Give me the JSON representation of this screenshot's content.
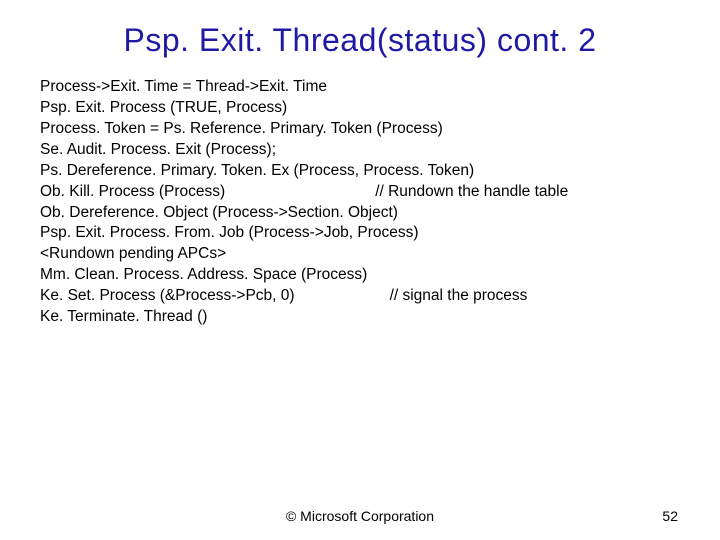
{
  "title": "Psp. Exit. Thread(status) cont. 2",
  "lines": {
    "l0": "Process->Exit. Time = Thread->Exit. Time",
    "l1": "Psp. Exit. Process (TRUE, Process)",
    "l2": "Process. Token = Ps. Reference. Primary. Token (Process)",
    "l3": "Se. Audit. Process. Exit (Process);",
    "l4": "Ps. Dereference. Primary. Token. Ex (Process, Process. Token)",
    "l5_left": "Ob. Kill. Process (Process)",
    "l5_right": "// Rundown the handle table",
    "l6": "Ob. Dereference. Object (Process->Section. Object)",
    "l7": "Psp. Exit. Process. From. Job (Process->Job, Process)",
    "l8": "<Rundown pending APCs>",
    "l9": "Mm. Clean. Process. Address. Space (Process)",
    "l10_left": "Ke. Set. Process (&Process->Pcb, 0)",
    "l10_right": "// signal the process",
    "l11": "Ke. Terminate. Thread ()"
  },
  "footer": {
    "copyright": "© Microsoft Corporation",
    "page": "52"
  }
}
